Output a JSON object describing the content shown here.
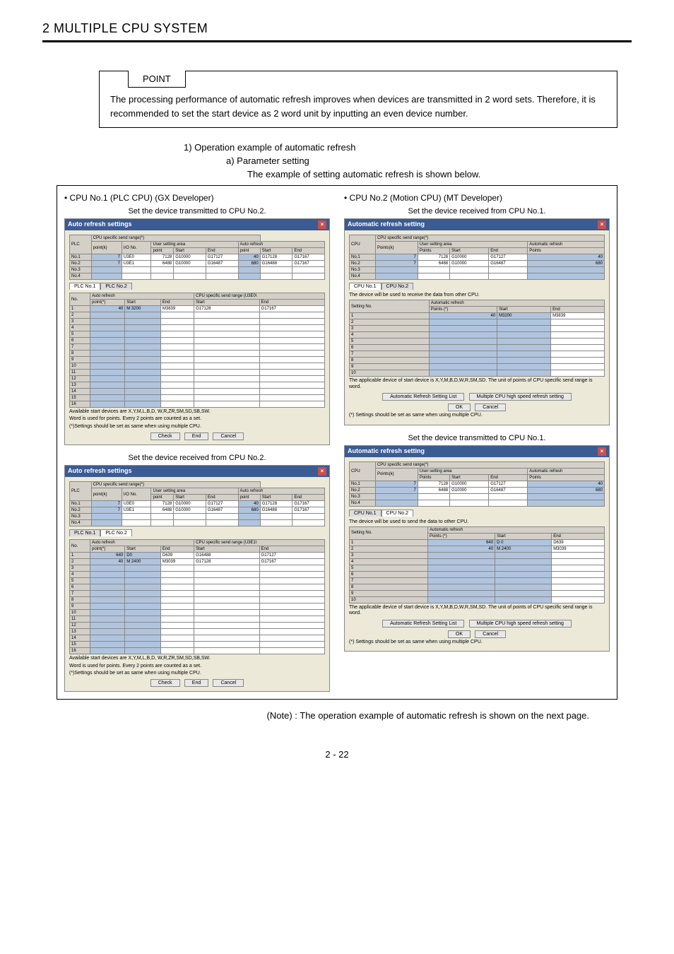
{
  "chapter": "2   MULTIPLE CPU SYSTEM",
  "point": {
    "label": "POINT",
    "text": "The processing performance of automatic refresh improves when devices are transmitted in 2 word sets. Therefore, it is recommended to set the start device as 2 word unit by inputting an even device number."
  },
  "list": {
    "item1": "1)   Operation example of automatic refresh",
    "itemA": "a)   Parameter setting",
    "sub": "The example of setting automatic refresh is shown below."
  },
  "panels": {
    "left_title": "• CPU No.1 (PLC CPU) (GX Developer)",
    "right_title": "• CPU No.2 (Motion CPU) (MT Developer)",
    "tx_no2": "Set the device transmitted to CPU No.2.",
    "rx_no1": "Set the device received from CPU No.1.",
    "rx_no2": "Set the device received from CPU No.2.",
    "tx_no1": "Set the device transmitted to CPU No.1."
  },
  "dialog": {
    "title_gx": "Auto refresh settings",
    "title_mt": "Automatic refresh setting",
    "cpu_header": "CPU specific send range(*)",
    "user_area": "User setting area",
    "auto_refresh": "Auto refresh",
    "automatic_refresh": "Automatic refresh",
    "plc": "PLC",
    "cpu": "CPU",
    "points_k": "Points(k)",
    "pointk": "point(k)",
    "io_no": "I/O No.",
    "point": "point",
    "points": "Points",
    "start": "Start",
    "end": "End",
    "no1": "No.1",
    "no2": "No.2",
    "no3": "No.3",
    "no4": "No.4",
    "row1_vals": {
      "pk": "7",
      "io": "U3E0",
      "pt": "7128",
      "st": "G10000",
      "en": "G17127",
      "pt2": "40",
      "st2": "G17128",
      "en2": "G17167"
    },
    "row2_vals": {
      "pk": "7",
      "io": "U3E1",
      "pt": "6488",
      "st": "G10000",
      "en": "G16487",
      "pt2": "680",
      "st2": "G16488",
      "en2": "G17167"
    },
    "tab_plc1": "PLC No.1",
    "tab_plc2": "PLC No.2",
    "tab_cpu1": "CPU No.1",
    "tab_cpu2": "CPU No.2",
    "no": "No.",
    "setting_no": "Setting No.",
    "points_star": "Points (*)",
    "point_star": "point(*)",
    "cpu_spec_u3e0": "CPU specific send range (U3E0\\",
    "ar_row_40": {
      "pt": "40",
      "st": "M 3200",
      "en": "M3839",
      "st2": "G17128",
      "en2": "G17167"
    },
    "rx_row1": {
      "pt": "640",
      "st": "D0",
      "en": "D639",
      "st2": "G16488",
      "en2": "G17127"
    },
    "rx_row2": {
      "pt": "40",
      "st": "M 2400",
      "en": "M3039",
      "st2": "G17128",
      "en2": "G17167"
    },
    "mt_rx_row": {
      "pt": "40",
      "st": "M3200",
      "en": "M3839"
    },
    "mt_tx_row1": {
      "pt": "640",
      "st": "D 0",
      "en": "D639"
    },
    "mt_tx_row2": {
      "pt": "40",
      "st": "M 2400",
      "en": "M3039"
    },
    "mt_top_row1": {
      "pk": "7",
      "pt": "7128",
      "st": "G10000",
      "en": "G17127",
      "pt2": "40"
    },
    "mt_top_row2": {
      "pk": "7",
      "pt": "6488",
      "st": "G10000",
      "en": "G16487",
      "pt2": "680"
    },
    "avail_gx": "Available start devices are X,Y,M,L,B,D,\nW,R,ZR,SM,SD,SB,SW.",
    "word_note": "Word is used for points. Every 2 points are counted as a set.",
    "star_note": "(*)Settings should be set as same when using multiple CPU.",
    "star_note_mt": "(*) Settings should be set as same when using multiple CPU.",
    "mt_receive_note": "The device will be used to receive the data from other CPU.",
    "mt_send_note": "The device will be used to send the data to other CPU.",
    "mt_applicable": "The applicable device of start device is X,Y,M,B,D,W,R,SM,SD.\nThe unit of points of CPU specific send range is word.",
    "btn_check": "Check",
    "btn_end": "End",
    "btn_cancel": "Cancel",
    "btn_ok": "OK",
    "btn_auto_list": "Automatic Refresh Setting List",
    "btn_multi_hs": "Multiple CPU high speed refresh setting"
  },
  "footnote": "(Note) : The operation example of automatic refresh is shown on the next page.",
  "page": "2 - 22"
}
